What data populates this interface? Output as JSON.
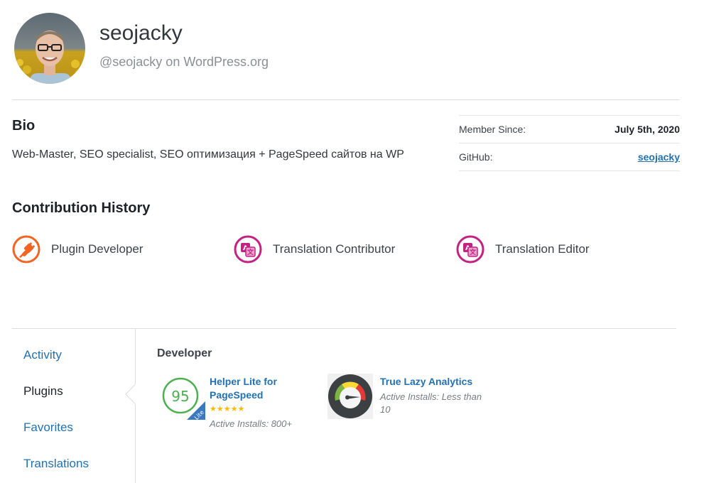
{
  "profile": {
    "username": "seojacky",
    "handle": "@seojacky on WordPress.org"
  },
  "bio": {
    "heading": "Bio",
    "text": "Web-Master, SEO specialist, SEO оптимизация + PageSpeed сайтов на WP"
  },
  "meta": {
    "member_since_label": "Member Since:",
    "member_since_value": "July 5th, 2020",
    "github_label": "GitHub:",
    "github_value": "seojacky"
  },
  "contribution": {
    "heading": "Contribution History",
    "badges": [
      {
        "label": "Plugin Developer",
        "icon": "plugin-plug-icon",
        "color": "#f16422"
      },
      {
        "label": "Translation Contributor",
        "icon": "translation-icon",
        "color": "#c32283"
      },
      {
        "label": "Translation Editor",
        "icon": "translation-icon",
        "color": "#c32283"
      }
    ]
  },
  "sidebar": {
    "items": [
      {
        "label": "Activity",
        "active": false
      },
      {
        "label": "Plugins",
        "active": true
      },
      {
        "label": "Favorites",
        "active": false
      },
      {
        "label": "Translations",
        "active": false
      }
    ]
  },
  "developer": {
    "heading": "Developer",
    "plugins": [
      {
        "title_line1": "Helper Lite for",
        "title_line2": "PageSpeed",
        "rating_stars": "★★★★★",
        "installs": "Active Installs: 800+",
        "icon_score": "95",
        "icon_tag": "Lite"
      },
      {
        "title_line1": "True Lazy Analytics",
        "installs_line1": "Active Installs: Less than",
        "installs_line2": "10",
        "icon": "gauge-icon"
      }
    ]
  },
  "colors": {
    "link": "#2271b1",
    "plugin_dev_orange": "#f16422",
    "translation_magenta": "#c32283",
    "stars": "#ffb900",
    "score_green": "#4caf50"
  }
}
